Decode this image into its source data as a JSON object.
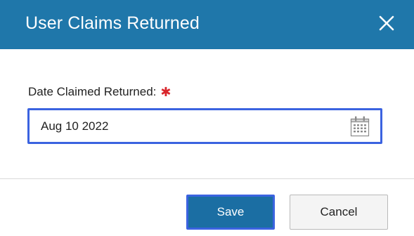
{
  "dialog": {
    "title": "User Claims Returned",
    "close_icon": "close-icon"
  },
  "form": {
    "date_label": "Date Claimed Returned:",
    "required_mark": "✱",
    "date_value": "Aug 10 2022",
    "calendar_icon": "calendar-icon"
  },
  "footer": {
    "save_label": "Save",
    "cancel_label": "Cancel"
  },
  "colors": {
    "header_bg": "#1f77aa",
    "focus_border": "#3b63e0",
    "required": "#d9262c",
    "primary_button": "#1b6ea3"
  }
}
